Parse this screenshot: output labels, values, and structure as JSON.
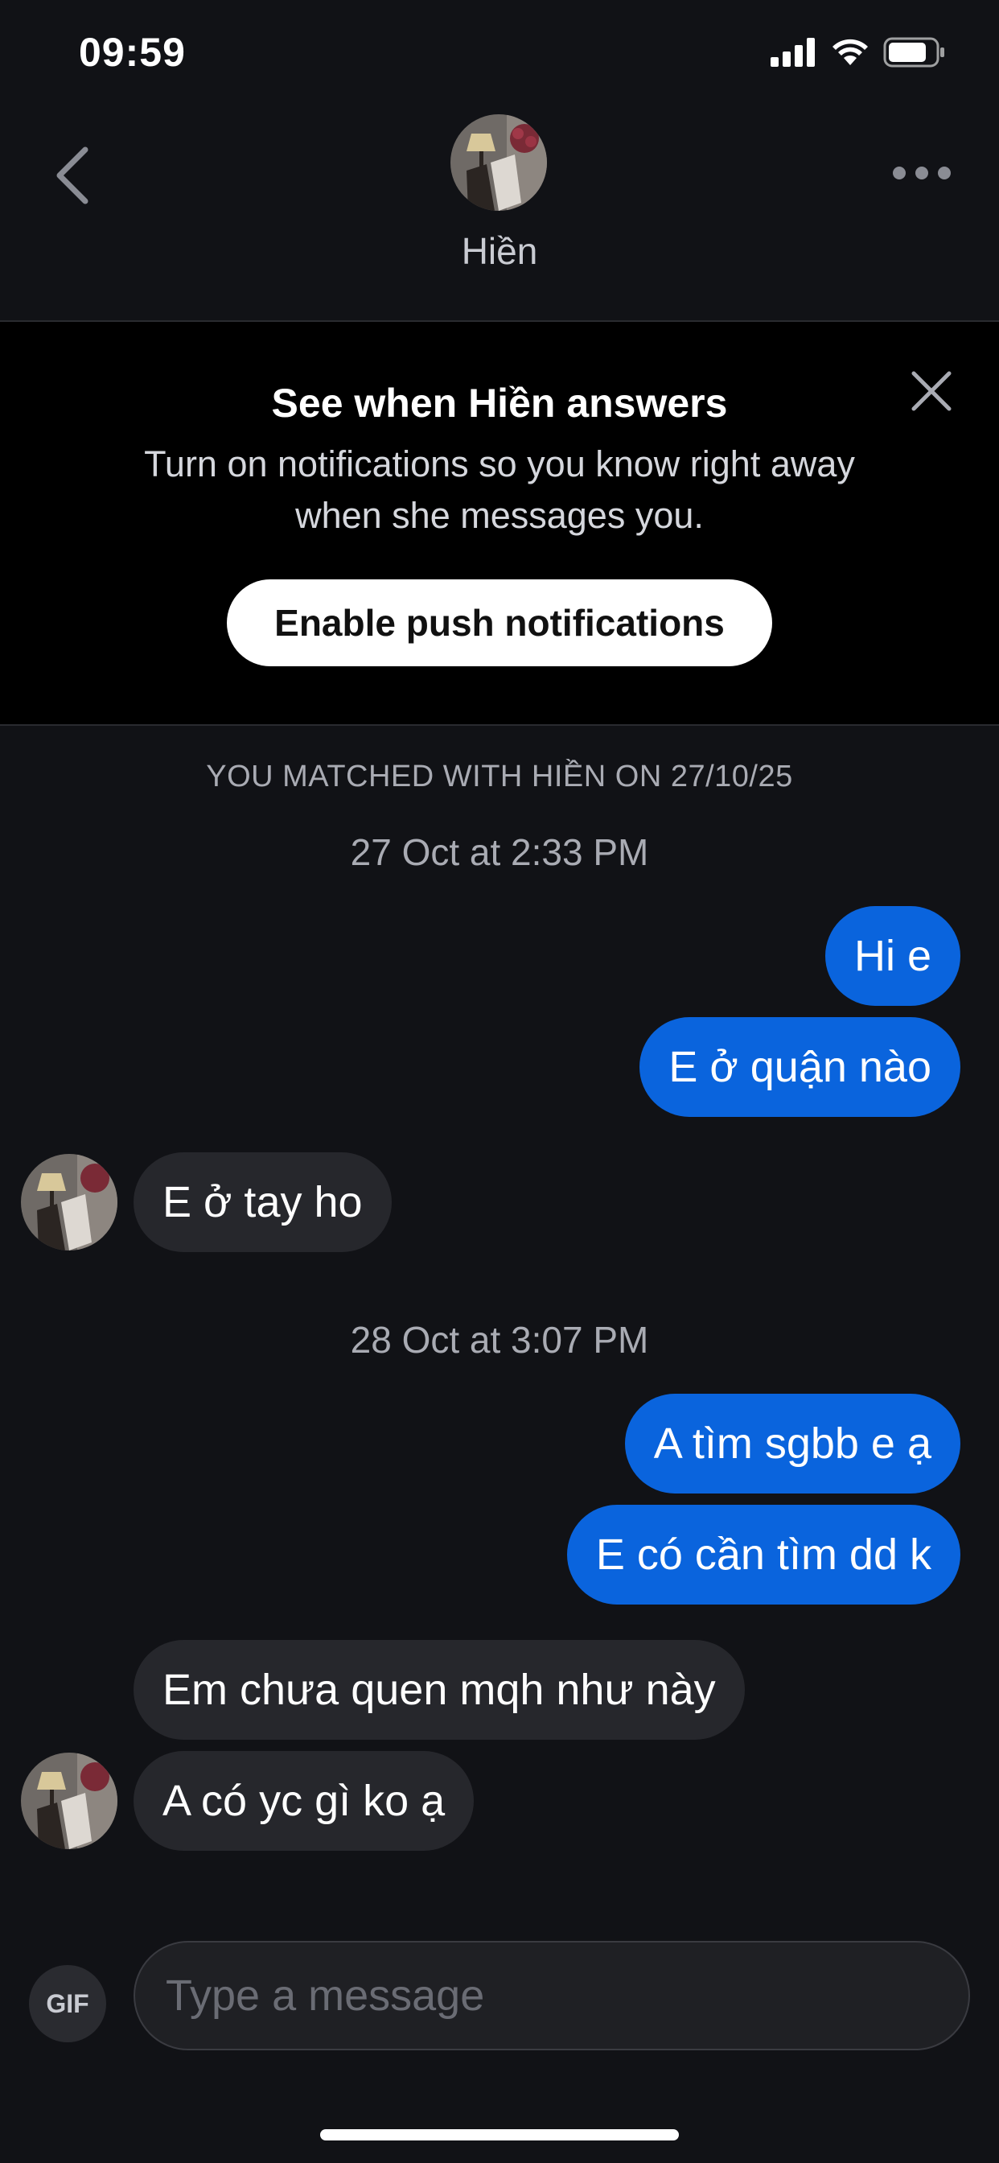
{
  "status_bar": {
    "time": "09:59"
  },
  "header": {
    "contact_name": "Hiền"
  },
  "notice": {
    "title": "See when Hiền answers",
    "body": "Turn on notifications so you know right away when she messages you.",
    "button_label": "Enable push notifications"
  },
  "conversation": {
    "match_text": "YOU MATCHED WITH HIỀN ON 27/10/25",
    "date1": "27 Oct at 2:33 PM",
    "msg1": "Hi e",
    "msg2": "E ở quận nào",
    "msg3": "E ở tay ho",
    "date2": "28 Oct at 3:07 PM",
    "msg4": "A tìm sgbb e ạ",
    "msg5": "E có cần tìm dd k",
    "msg6": "Em chưa quen mqh như này",
    "msg7": "A có yc gì ko ạ"
  },
  "composer": {
    "gif_label": "GIF",
    "placeholder": "Type a message"
  },
  "colors": {
    "background": "#111216",
    "outgoing_bubble": "#0a64dd",
    "incoming_bubble": "#26272c"
  },
  "icons": [
    "back-chevron-icon",
    "more-dots-icon",
    "close-icon",
    "signal-icon",
    "wifi-icon",
    "battery-icon"
  ]
}
